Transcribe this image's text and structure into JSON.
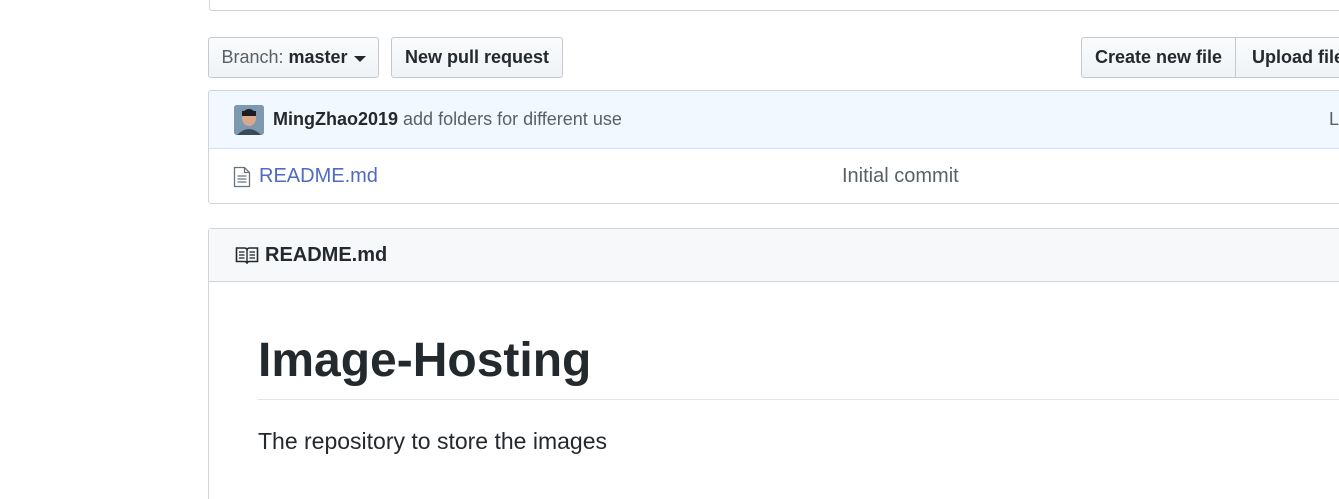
{
  "toolbar": {
    "branch_label": "Branch:",
    "branch_value": "master",
    "new_pr_label": "New pull request",
    "create_file_label": "Create new file",
    "upload_files_label": "Upload files"
  },
  "commit": {
    "author": "MingZhao2019",
    "message": "add folders for different use",
    "right_text": "L"
  },
  "files": [
    {
      "name": "README.md",
      "last_commit": "Initial commit",
      "icon": "file-icon"
    }
  ],
  "readme": {
    "header_title": "README.md",
    "header_icon": "book-icon",
    "heading": "Image-Hosting",
    "paragraph": "The repository to store the images"
  },
  "colors": {
    "link": "#4f6ac0",
    "commit_bar_bg": "#f1f8ff",
    "border": "#d1d5da"
  }
}
